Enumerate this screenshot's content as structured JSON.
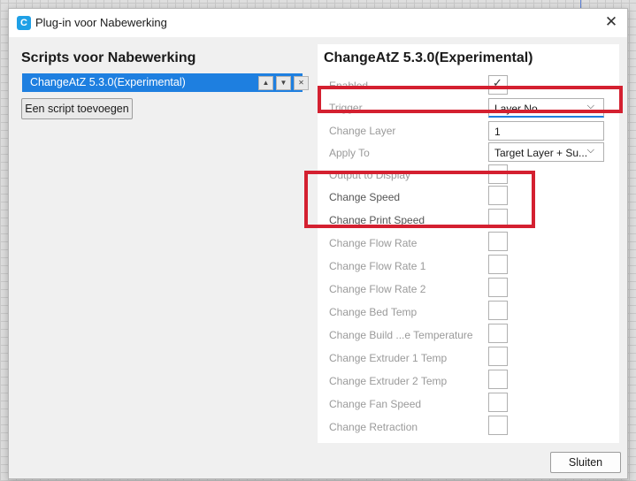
{
  "window": {
    "title": "Plug-in voor Nabewerking",
    "logo_letter": "C",
    "close_symbol": "✕"
  },
  "left": {
    "title": "Scripts voor Nabewerking",
    "scripts": [
      {
        "label": "ChangeAtZ 5.3.0(Experimental)"
      }
    ],
    "move_up_symbol": "▲",
    "move_down_symbol": "▼",
    "remove_symbol": "✕",
    "add_script_label": "Een script toevoegen"
  },
  "right": {
    "title": "ChangeAtZ 5.3.0(Experimental)",
    "settings": {
      "enabled": {
        "label": "Enabled",
        "checked": true
      },
      "trigger": {
        "label": "Trigger",
        "value": "Layer No."
      },
      "change_layer": {
        "label": "Change Layer",
        "value": "1"
      },
      "apply_to": {
        "label": "Apply To",
        "value": "Target Layer + Su..."
      },
      "output_to_display": {
        "label": "Output to Display",
        "checked": false
      },
      "change_speed": {
        "label": "Change Speed",
        "checked": false
      },
      "change_print_speed": {
        "label": "Change Print Speed",
        "checked": false
      },
      "change_flow_rate": {
        "label": "Change Flow Rate",
        "checked": false
      },
      "change_flow_rate_1": {
        "label": "Change Flow Rate 1",
        "checked": false
      },
      "change_flow_rate_2": {
        "label": "Change Flow Rate 2",
        "checked": false
      },
      "change_bed_temp": {
        "label": "Change Bed Temp",
        "checked": false
      },
      "change_build_temp": {
        "label": "Change Build ...e Temperature",
        "checked": false
      },
      "change_extruder_1_temp": {
        "label": "Change Extruder 1 Temp",
        "checked": false
      },
      "change_extruder_2_temp": {
        "label": "Change Extruder 2 Temp",
        "checked": false
      },
      "change_fan_speed": {
        "label": "Change Fan Speed",
        "checked": false
      },
      "change_retraction": {
        "label": "Change Retraction",
        "checked": false
      }
    },
    "chevron_symbol": "⌵",
    "check_symbol": "✓"
  },
  "footer": {
    "close_label": "Sluiten"
  },
  "colors": {
    "accent": "#1e7fe0",
    "highlight": "#d42030"
  }
}
